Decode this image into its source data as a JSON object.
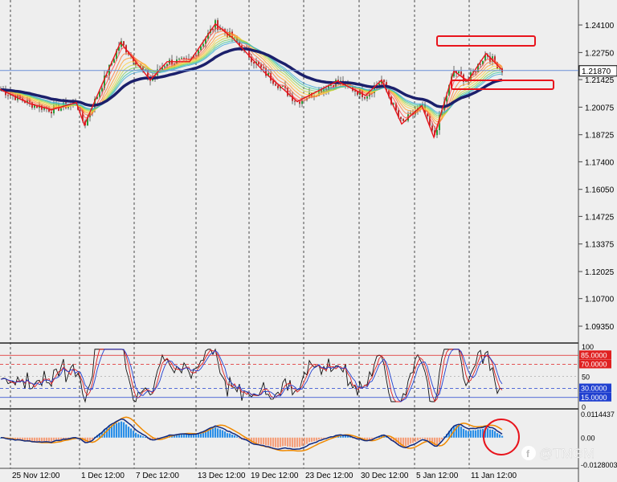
{
  "chart_data": [
    {
      "type": "candlestick",
      "panel": "price",
      "y_ticks": [
        "1.24100",
        "1.22750",
        "1.21425",
        "1.20075",
        "1.18725",
        "1.17400",
        "1.16050",
        "1.14725",
        "1.13375",
        "1.12025",
        "1.10700",
        "1.09350"
      ],
      "ylim": [
        1.088,
        1.2485
      ],
      "current_price": "1.21870",
      "current_price_value": 1.2187,
      "x_labels": [
        "25 Nov 12:00",
        "1 Dec 12:00",
        "7 Dec 12:00",
        "13 Dec 12:00",
        "19 Dec 12:00",
        "23 Dec 12:00",
        "30 Dec 12:00",
        "5 Jan 12:00",
        "11 Jan 12:00"
      ],
      "zigzag": [
        1.2095,
        1.2025,
        1.1995,
        1.203,
        1.192,
        1.2325,
        1.214,
        1.223,
        1.223,
        1.2415,
        1.2345,
        1.2175,
        1.2035,
        1.2135,
        1.2065,
        1.214,
        1.1925,
        1.2015,
        1.186,
        1.2185,
        1.2135,
        1.227,
        1.219
      ],
      "annotations": [
        "resistance-box",
        "support-box"
      ]
    },
    {
      "type": "line",
      "panel": "oscillator",
      "y_ticks": [
        "100",
        "85.0000",
        "70.0000",
        "50",
        "30.0000",
        "15.0000",
        "0"
      ],
      "levels": [
        {
          "value": 85,
          "label": "85.0000",
          "color": "#e02020"
        },
        {
          "value": 70,
          "label": "70.0000",
          "color": "#e02020"
        },
        {
          "value": 30,
          "label": "30.0000",
          "color": "#2040d0"
        },
        {
          "value": 15,
          "label": "15.0000",
          "color": "#2040d0"
        }
      ],
      "ylim": [
        0,
        100
      ]
    },
    {
      "type": "bar",
      "panel": "macd",
      "y_ticks": [
        "0.0114437",
        "0.00",
        "-0.0128003"
      ],
      "ylim": [
        -0.0128003,
        0.0114437
      ],
      "colors": {
        "positive": "#2a8fe8",
        "negative": "#f4a07c",
        "signal": "#f08a00",
        "main": "#102a80"
      }
    }
  ],
  "watermark": "@TMGM"
}
